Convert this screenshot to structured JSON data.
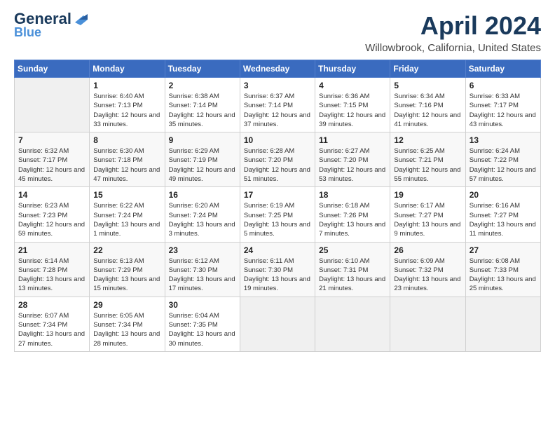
{
  "header": {
    "logo_general": "General",
    "logo_blue": "Blue",
    "month_title": "April 2024",
    "location": "Willowbrook, California, United States"
  },
  "days_of_week": [
    "Sunday",
    "Monday",
    "Tuesday",
    "Wednesday",
    "Thursday",
    "Friday",
    "Saturday"
  ],
  "weeks": [
    [
      {
        "day": "",
        "info": ""
      },
      {
        "day": "1",
        "info": "Sunrise: 6:40 AM\nSunset: 7:13 PM\nDaylight: 12 hours\nand 33 minutes."
      },
      {
        "day": "2",
        "info": "Sunrise: 6:38 AM\nSunset: 7:14 PM\nDaylight: 12 hours\nand 35 minutes."
      },
      {
        "day": "3",
        "info": "Sunrise: 6:37 AM\nSunset: 7:14 PM\nDaylight: 12 hours\nand 37 minutes."
      },
      {
        "day": "4",
        "info": "Sunrise: 6:36 AM\nSunset: 7:15 PM\nDaylight: 12 hours\nand 39 minutes."
      },
      {
        "day": "5",
        "info": "Sunrise: 6:34 AM\nSunset: 7:16 PM\nDaylight: 12 hours\nand 41 minutes."
      },
      {
        "day": "6",
        "info": "Sunrise: 6:33 AM\nSunset: 7:17 PM\nDaylight: 12 hours\nand 43 minutes."
      }
    ],
    [
      {
        "day": "7",
        "info": "Sunrise: 6:32 AM\nSunset: 7:17 PM\nDaylight: 12 hours\nand 45 minutes."
      },
      {
        "day": "8",
        "info": "Sunrise: 6:30 AM\nSunset: 7:18 PM\nDaylight: 12 hours\nand 47 minutes."
      },
      {
        "day": "9",
        "info": "Sunrise: 6:29 AM\nSunset: 7:19 PM\nDaylight: 12 hours\nand 49 minutes."
      },
      {
        "day": "10",
        "info": "Sunrise: 6:28 AM\nSunset: 7:20 PM\nDaylight: 12 hours\nand 51 minutes."
      },
      {
        "day": "11",
        "info": "Sunrise: 6:27 AM\nSunset: 7:20 PM\nDaylight: 12 hours\nand 53 minutes."
      },
      {
        "day": "12",
        "info": "Sunrise: 6:25 AM\nSunset: 7:21 PM\nDaylight: 12 hours\nand 55 minutes."
      },
      {
        "day": "13",
        "info": "Sunrise: 6:24 AM\nSunset: 7:22 PM\nDaylight: 12 hours\nand 57 minutes."
      }
    ],
    [
      {
        "day": "14",
        "info": "Sunrise: 6:23 AM\nSunset: 7:23 PM\nDaylight: 12 hours\nand 59 minutes."
      },
      {
        "day": "15",
        "info": "Sunrise: 6:22 AM\nSunset: 7:24 PM\nDaylight: 13 hours\nand 1 minute."
      },
      {
        "day": "16",
        "info": "Sunrise: 6:20 AM\nSunset: 7:24 PM\nDaylight: 13 hours\nand 3 minutes."
      },
      {
        "day": "17",
        "info": "Sunrise: 6:19 AM\nSunset: 7:25 PM\nDaylight: 13 hours\nand 5 minutes."
      },
      {
        "day": "18",
        "info": "Sunrise: 6:18 AM\nSunset: 7:26 PM\nDaylight: 13 hours\nand 7 minutes."
      },
      {
        "day": "19",
        "info": "Sunrise: 6:17 AM\nSunset: 7:27 PM\nDaylight: 13 hours\nand 9 minutes."
      },
      {
        "day": "20",
        "info": "Sunrise: 6:16 AM\nSunset: 7:27 PM\nDaylight: 13 hours\nand 11 minutes."
      }
    ],
    [
      {
        "day": "21",
        "info": "Sunrise: 6:14 AM\nSunset: 7:28 PM\nDaylight: 13 hours\nand 13 minutes."
      },
      {
        "day": "22",
        "info": "Sunrise: 6:13 AM\nSunset: 7:29 PM\nDaylight: 13 hours\nand 15 minutes."
      },
      {
        "day": "23",
        "info": "Sunrise: 6:12 AM\nSunset: 7:30 PM\nDaylight: 13 hours\nand 17 minutes."
      },
      {
        "day": "24",
        "info": "Sunrise: 6:11 AM\nSunset: 7:30 PM\nDaylight: 13 hours\nand 19 minutes."
      },
      {
        "day": "25",
        "info": "Sunrise: 6:10 AM\nSunset: 7:31 PM\nDaylight: 13 hours\nand 21 minutes."
      },
      {
        "day": "26",
        "info": "Sunrise: 6:09 AM\nSunset: 7:32 PM\nDaylight: 13 hours\nand 23 minutes."
      },
      {
        "day": "27",
        "info": "Sunrise: 6:08 AM\nSunset: 7:33 PM\nDaylight: 13 hours\nand 25 minutes."
      }
    ],
    [
      {
        "day": "28",
        "info": "Sunrise: 6:07 AM\nSunset: 7:34 PM\nDaylight: 13 hours\nand 27 minutes."
      },
      {
        "day": "29",
        "info": "Sunrise: 6:05 AM\nSunset: 7:34 PM\nDaylight: 13 hours\nand 28 minutes."
      },
      {
        "day": "30",
        "info": "Sunrise: 6:04 AM\nSunset: 7:35 PM\nDaylight: 13 hours\nand 30 minutes."
      },
      {
        "day": "",
        "info": ""
      },
      {
        "day": "",
        "info": ""
      },
      {
        "day": "",
        "info": ""
      },
      {
        "day": "",
        "info": ""
      }
    ]
  ]
}
